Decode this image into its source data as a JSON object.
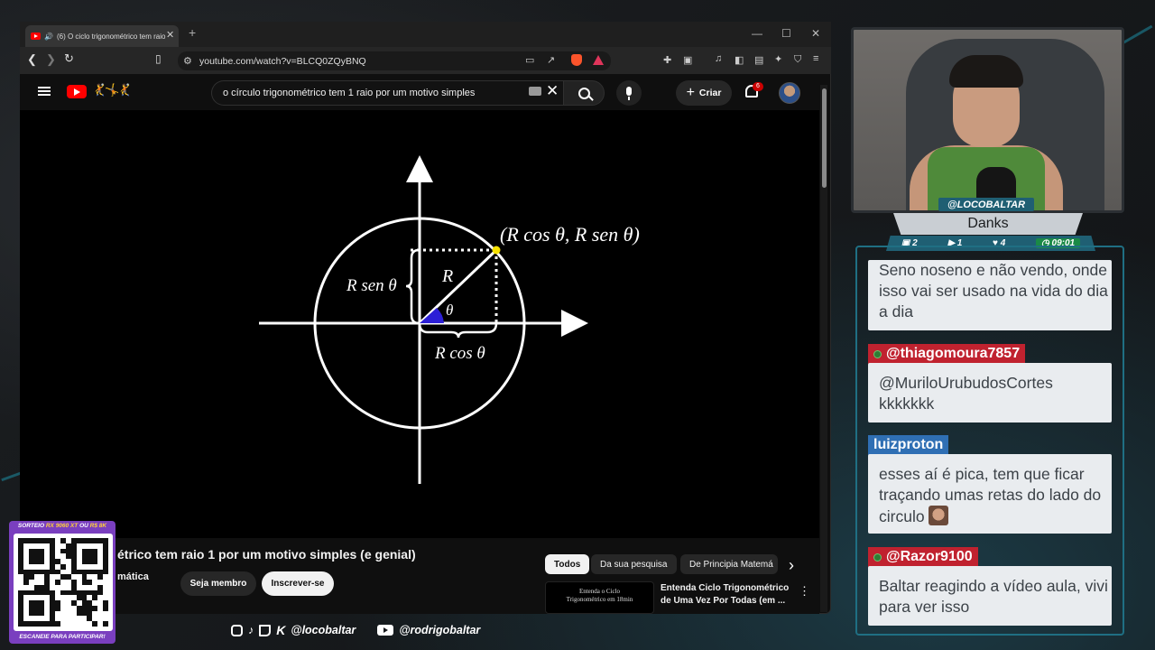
{
  "browser": {
    "tab_title": "(6) O ciclo trigonométrico tem raio",
    "tab_close": "✕",
    "new_tab": "+",
    "minimize": "—",
    "maximize": "☐",
    "close": "✕",
    "url": "youtube.com/watch?v=BLCQ0ZQyBNQ"
  },
  "youtube": {
    "search_query": "o círculo trigonométrico tem 1 raio por um motivo simples",
    "clear": "✕",
    "create_label": "Criar",
    "create_plus": "+",
    "notif_count": "6",
    "video_title": "étrico tem raio 1 por um motivo simples (e genial)",
    "channel_fragment": "mática",
    "member_button": "Seja membro",
    "subscribe_button": "Inscrever-se",
    "chips": [
      "Todos",
      "Da sua pesquisa",
      "De Principia Matemá"
    ],
    "chip_next": "›",
    "rec_thumb_line1": "Entenda o Ciclo",
    "rec_thumb_line2": "Trigonométrico em 18min",
    "rec_title": "Entenda Ciclo Trigonométrico de Uma Vez Por Todas (em ...",
    "more": "⋮"
  },
  "diagram": {
    "point_label": "(R cos θ, R sen θ)",
    "radius_label": "R",
    "angle_label": "θ",
    "sin_label": "R sen θ",
    "cos_label": "R cos θ"
  },
  "stream": {
    "handle": "@LOCOBALTAR",
    "game": "Danks",
    "stats": [
      "2",
      "1",
      "4"
    ],
    "timer": "09:01"
  },
  "chat": {
    "messages": [
      {
        "text": "Seno noseno e não vendo, onde isso vai ser usado na vida do dia a dia"
      },
      {
        "user": "@thiagomoura7857",
        "text": "@MuriloUrubudosCortes kkkkkkk"
      },
      {
        "user": "luizproton",
        "text": "esses aí é pica, tem que ficar traçando umas retas do lado do circulo"
      },
      {
        "user": "@Razor9100",
        "text": "Baltar reagindo a vídeo aula, vivi para ver isso"
      }
    ]
  },
  "raffle": {
    "prefix": "SORTEIO",
    "gpu": "RX 9060 XT",
    "or": "OU",
    "cash": "R$ 8K",
    "scan": "ESCANEIE PARA PARTICIPAR!"
  },
  "socials": {
    "k_glyph": "K",
    "handle1": "@locobaltar",
    "handle2": "@rodrigobaltar"
  }
}
